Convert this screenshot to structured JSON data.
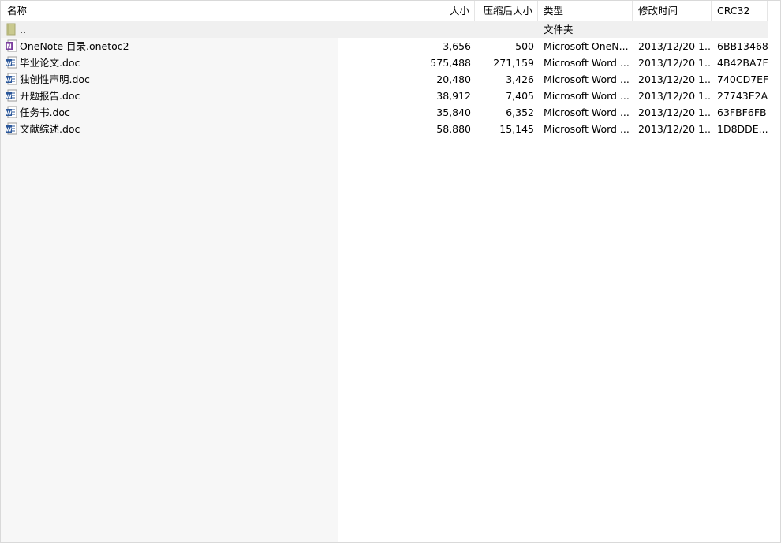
{
  "columns": {
    "name": "名称",
    "size": "大小",
    "packed": "压缩后大小",
    "type": "类型",
    "modified": "修改时间",
    "crc": "CRC32"
  },
  "sort_indicator": "^",
  "rows": [
    {
      "name": "..",
      "size": "",
      "packed": "",
      "type": "文件夹",
      "modified": "",
      "crc": "",
      "icon": "folder-icon"
    },
    {
      "name": "OneNote 目录.onetoc2",
      "size": "3,656",
      "packed": "500",
      "type": "Microsoft OneN...",
      "modified": "2013/12/20 1...",
      "crc": "6BB13468",
      "icon": "onenote-icon"
    },
    {
      "name": "毕业论文.doc",
      "size": "575,488",
      "packed": "271,159",
      "type": "Microsoft Word ...",
      "modified": "2013/12/20 1...",
      "crc": "4B42BA7F",
      "icon": "word-doc-icon"
    },
    {
      "name": "独创性声明.doc",
      "size": "20,480",
      "packed": "3,426",
      "type": "Microsoft Word ...",
      "modified": "2013/12/20 1...",
      "crc": "740CD7EF",
      "icon": "word-doc-icon"
    },
    {
      "name": "开题报告.doc",
      "size": "38,912",
      "packed": "7,405",
      "type": "Microsoft Word ...",
      "modified": "2013/12/20 1...",
      "crc": "27743E2A",
      "icon": "word-doc-icon"
    },
    {
      "name": "任务书.doc",
      "size": "35,840",
      "packed": "6,352",
      "type": "Microsoft Word ...",
      "modified": "2013/12/20 1...",
      "crc": "63FBF6FB",
      "icon": "word-doc-icon"
    },
    {
      "name": "文献综述.doc",
      "size": "58,880",
      "packed": "15,145",
      "type": "Microsoft Word ...",
      "modified": "2013/12/20 1...",
      "crc": "1D8DDE...",
      "icon": "word-doc-icon"
    }
  ]
}
